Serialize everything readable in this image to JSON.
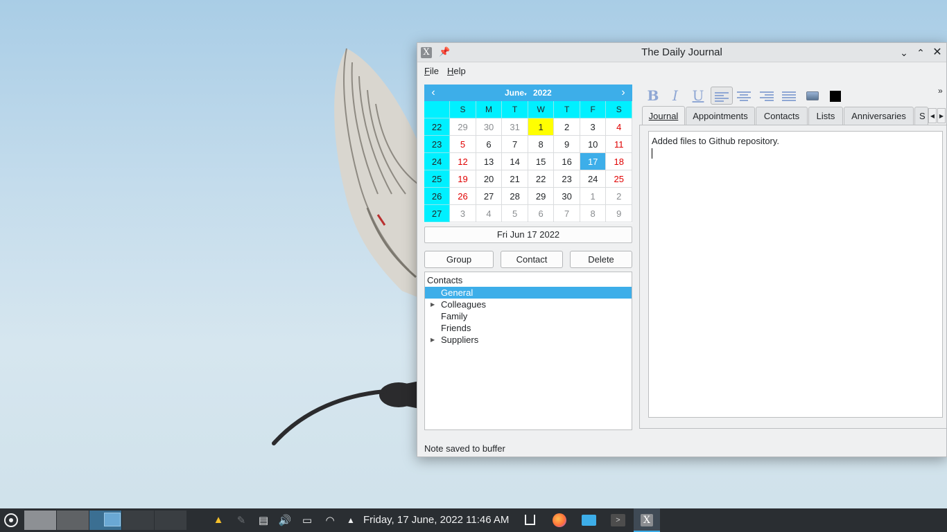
{
  "window": {
    "title": "The Daily Journal",
    "menu": [
      {
        "accel": "F",
        "rest": "ile"
      },
      {
        "accel": "H",
        "rest": "elp"
      }
    ]
  },
  "calendar": {
    "month": "June",
    "year": "2022",
    "weekday_headers": [
      "S",
      "M",
      "T",
      "W",
      "T",
      "F",
      "S"
    ],
    "weeks": [
      {
        "week": "22",
        "days": [
          [
            "29",
            "other"
          ],
          [
            "30",
            "other"
          ],
          [
            "31",
            "other"
          ],
          [
            "1",
            "today"
          ],
          [
            "2",
            ""
          ],
          [
            "3",
            ""
          ],
          [
            "4",
            "red"
          ]
        ]
      },
      {
        "week": "23",
        "days": [
          [
            "5",
            "red"
          ],
          [
            "6",
            ""
          ],
          [
            "7",
            ""
          ],
          [
            "8",
            ""
          ],
          [
            "9",
            ""
          ],
          [
            "10",
            ""
          ],
          [
            "11",
            "red"
          ]
        ]
      },
      {
        "week": "24",
        "days": [
          [
            "12",
            "red"
          ],
          [
            "13",
            ""
          ],
          [
            "14",
            ""
          ],
          [
            "15",
            ""
          ],
          [
            "16",
            ""
          ],
          [
            "17",
            "sel"
          ],
          [
            "18",
            "red"
          ]
        ]
      },
      {
        "week": "25",
        "days": [
          [
            "19",
            "red"
          ],
          [
            "20",
            ""
          ],
          [
            "21",
            ""
          ],
          [
            "22",
            ""
          ],
          [
            "23",
            ""
          ],
          [
            "24",
            ""
          ],
          [
            "25",
            "red"
          ]
        ]
      },
      {
        "week": "26",
        "days": [
          [
            "26",
            "red"
          ],
          [
            "27",
            ""
          ],
          [
            "28",
            ""
          ],
          [
            "29",
            ""
          ],
          [
            "30",
            ""
          ],
          [
            "1",
            "other"
          ],
          [
            "2",
            "other"
          ]
        ]
      },
      {
        "week": "27",
        "days": [
          [
            "3",
            "other"
          ],
          [
            "4",
            "other"
          ],
          [
            "5",
            "other"
          ],
          [
            "6",
            "other"
          ],
          [
            "7",
            "other"
          ],
          [
            "8",
            "other"
          ],
          [
            "9",
            "other"
          ]
        ]
      }
    ],
    "colors": {
      "header": "#3daee9",
      "week_column": "#00f0ff",
      "today": "#ffff00",
      "weekend": "#e00000"
    }
  },
  "selected_date": "Fri Jun 17 2022",
  "buttons": {
    "group": "Group",
    "contact": "Contact",
    "delete": "Delete"
  },
  "contacts": {
    "header": "Contacts",
    "items": [
      {
        "label": "General",
        "selected": true,
        "expandable": false
      },
      {
        "label": "Colleagues",
        "selected": false,
        "expandable": true
      },
      {
        "label": "Family",
        "selected": false,
        "expandable": false
      },
      {
        "label": "Friends",
        "selected": false,
        "expandable": false
      },
      {
        "label": "Suppliers",
        "selected": false,
        "expandable": true
      }
    ]
  },
  "status": "Note saved to buffer",
  "toolbar": {
    "bold": "B",
    "italic": "I",
    "underline": "U",
    "overflow": "»"
  },
  "tabs": [
    "Journal",
    "Appointments",
    "Contacts",
    "Lists",
    "Anniversaries",
    "S"
  ],
  "active_tab": "Journal",
  "editor": {
    "text": "Added files to Github repository."
  },
  "taskbar": {
    "clock": "Friday, 17 June, 2022  11:46 AM"
  }
}
